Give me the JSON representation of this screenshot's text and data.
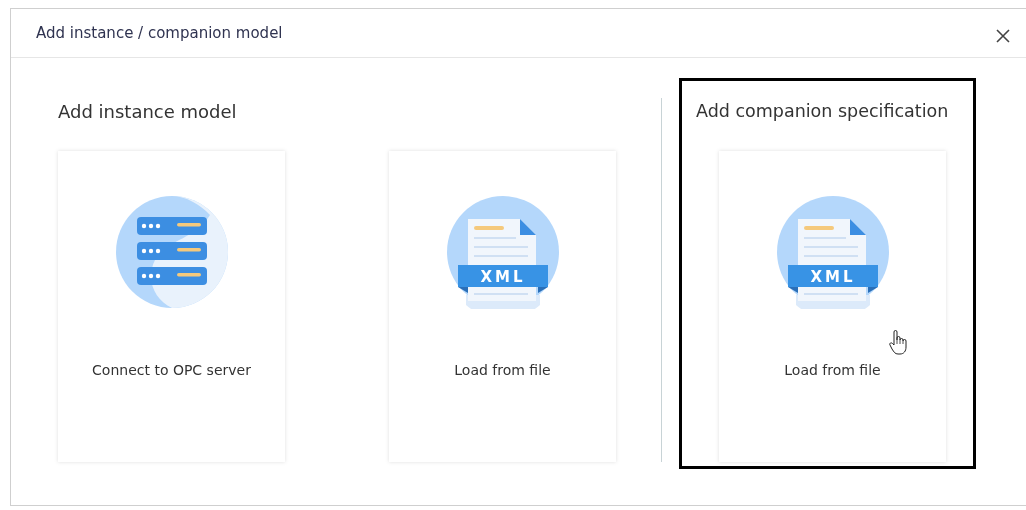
{
  "dialog": {
    "title": "Add instance / companion model"
  },
  "sections": [
    {
      "heading": "Add instance model",
      "highlighted": false,
      "cards": [
        {
          "kind": "server",
          "label": "Connect to OPC server",
          "hovered": false
        },
        {
          "kind": "xml",
          "badge": "XML",
          "label": "Load from file",
          "hovered": false
        }
      ]
    },
    {
      "heading": "Add companion specification",
      "highlighted": true,
      "cards": [
        {
          "kind": "xml",
          "badge": "XML",
          "label": "Load from file",
          "hovered": true
        }
      ]
    }
  ]
}
